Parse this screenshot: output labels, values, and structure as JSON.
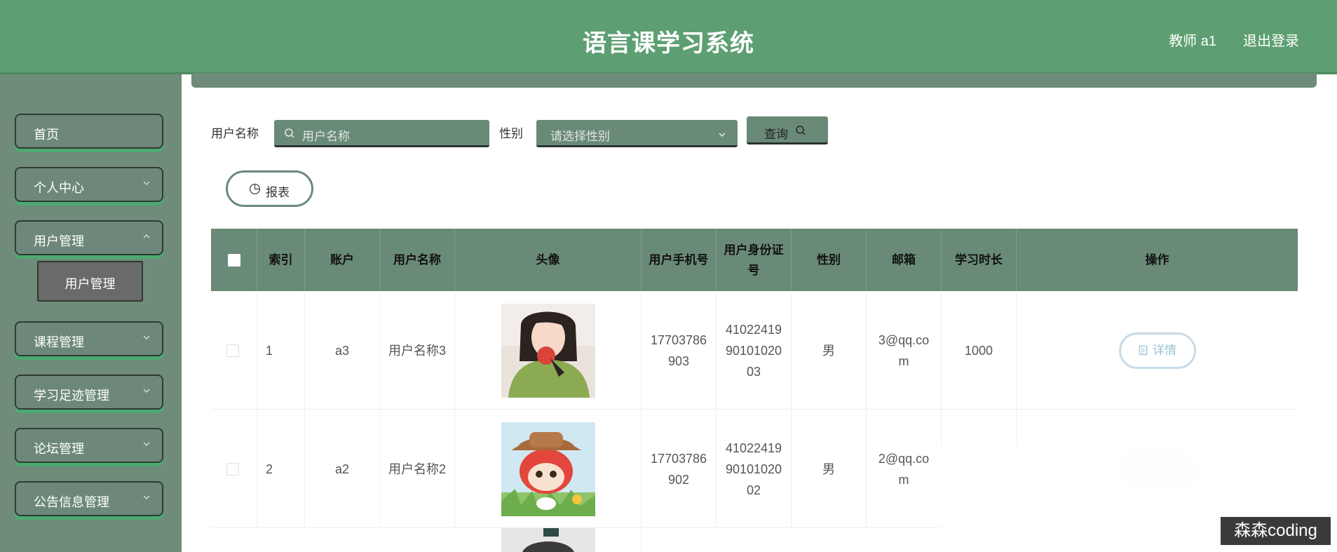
{
  "header": {
    "title": "语言课学习系统",
    "user": "教师 a1",
    "logout": "退出登录"
  },
  "sidebar": {
    "items": [
      {
        "label": "首页"
      },
      {
        "label": "个人中心"
      },
      {
        "label": "用户管理"
      },
      {
        "label": "课程管理"
      },
      {
        "label": "学习足迹管理"
      },
      {
        "label": "论坛管理"
      },
      {
        "label": "公告信息管理"
      }
    ],
    "sub_item": "用户管理"
  },
  "search": {
    "username_label": "用户名称",
    "username_placeholder": "用户名称",
    "gender_label": "性别",
    "gender_placeholder": "请选择性别",
    "query_label": "查询",
    "report_label": "报表"
  },
  "table": {
    "headers": [
      "索引",
      "账户",
      "用户名称",
      "头像",
      "用户手机号",
      "用户身份证号",
      "性别",
      "邮箱",
      "学习时长",
      "操作"
    ],
    "rows": [
      {
        "index": "1",
        "account": "a3",
        "name": "用户名称3",
        "phone": "17703786903",
        "id_no": "410224199010102003",
        "gender": "男",
        "email": "3@qq.com",
        "study_time": "1000",
        "action": "详情"
      },
      {
        "index": "2",
        "account": "a2",
        "name": "用户名称2",
        "phone": "17703786902",
        "id_no": "410224199010102002",
        "gender": "男",
        "email": "2@qq.com",
        "study_time": "",
        "action": ""
      }
    ]
  },
  "watermark": "森森coding"
}
